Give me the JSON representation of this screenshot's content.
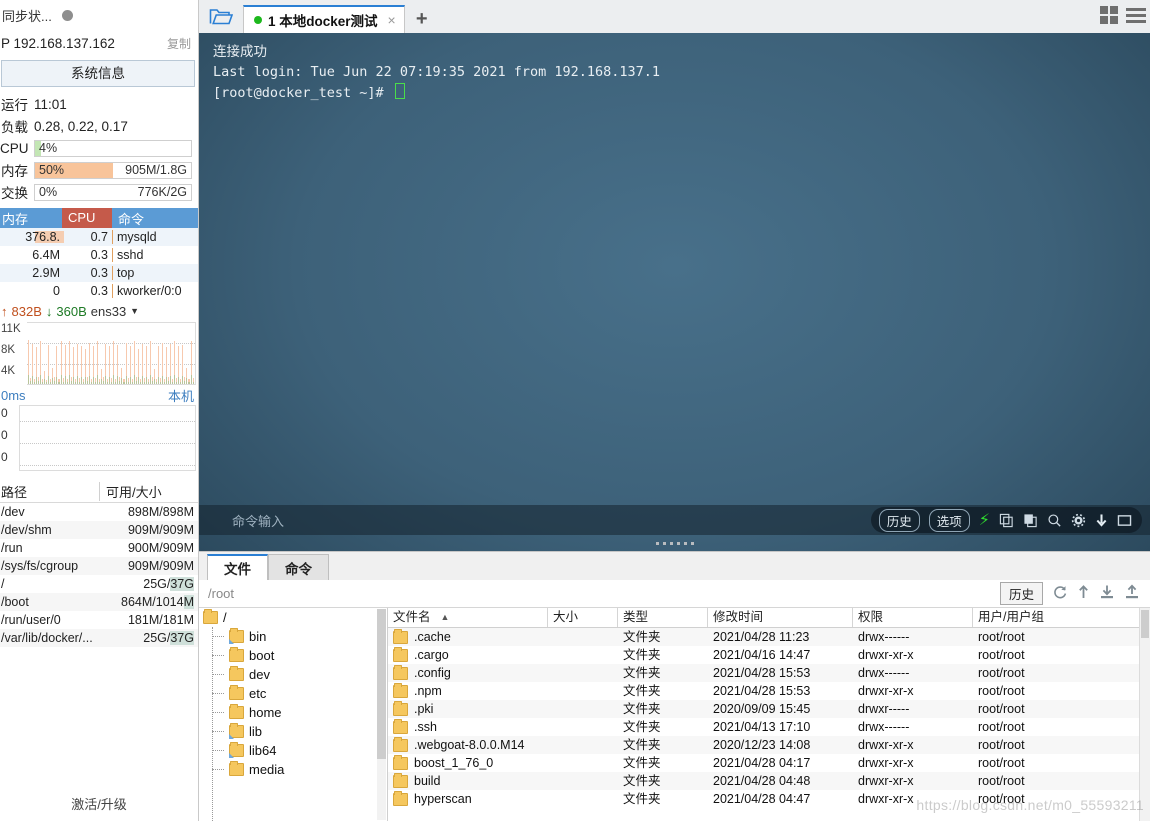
{
  "monitor": {
    "sync_label": "同步状...",
    "ip_label": "P 192.168.137.162",
    "copy_label": "复制",
    "sysinfo_button": "系统信息",
    "uptime_key": "运行",
    "uptime_value": "11:01",
    "load_key": "负载",
    "load_value": "0.28, 0.22, 0.17",
    "meters": [
      {
        "key": "CPU",
        "percent": "4%",
        "detail": "",
        "fill_pct": 4,
        "color": "#c3e6b4"
      },
      {
        "key": "内存",
        "percent": "50%",
        "detail": "905M/1.8G",
        "fill_pct": 50,
        "color": "#f8c49a"
      },
      {
        "key": "交换",
        "percent": "0%",
        "detail": "776K/2G",
        "fill_pct": 0,
        "color": "#f8c49a"
      }
    ],
    "process_table": {
      "headers": [
        "内存",
        "CPU",
        "命令"
      ],
      "rows": [
        {
          "mem": "376.8.",
          "cpu": "0.7",
          "cmd": "mysqld",
          "membar": 46
        },
        {
          "mem": "6.4M",
          "cpu": "0.3",
          "cmd": "sshd",
          "membar": 0
        },
        {
          "mem": "2.9M",
          "cpu": "0.3",
          "cmd": "top",
          "membar": 0
        },
        {
          "mem": "0",
          "cpu": "0.3",
          "cmd": "kworker/0:0",
          "membar": 0
        }
      ]
    },
    "network": {
      "upload": "832B",
      "download": "360B",
      "interface": "ens33",
      "y_labels": [
        "11K",
        "8K",
        "4K"
      ],
      "bars": [
        72,
        10,
        66,
        8,
        60,
        12,
        70,
        9,
        22,
        7,
        64,
        9,
        26,
        11,
        62,
        8,
        70,
        10,
        64,
        9,
        70,
        12,
        60,
        8,
        66,
        10,
        62,
        9,
        58,
        11,
        68,
        8,
        62,
        10,
        70,
        9,
        24,
        12,
        66,
        8,
        62,
        10,
        70,
        9,
        64,
        11,
        26,
        8,
        68,
        10,
        62,
        9,
        70,
        12,
        58,
        8,
        66,
        10,
        62,
        9,
        70,
        11,
        24,
        8,
        62,
        10,
        68,
        9,
        60,
        12,
        66,
        8,
        70,
        10,
        62,
        9,
        64,
        11,
        26,
        8,
        70,
        10
      ],
      "bars_base": [
        14,
        5,
        13,
        4,
        12,
        5,
        14,
        4,
        9,
        4,
        13,
        4,
        10,
        5,
        12,
        4,
        14,
        4,
        13,
        4,
        14,
        5,
        12,
        4,
        13,
        4,
        12,
        4,
        11,
        5,
        13,
        4,
        12,
        4,
        14,
        4,
        9,
        5,
        13,
        4,
        12,
        4,
        14,
        4,
        13,
        5,
        10,
        4,
        13,
        4,
        12,
        4,
        14,
        5,
        11,
        4,
        13,
        4,
        12,
        4,
        14,
        5,
        9,
        4,
        12,
        4,
        13,
        4,
        12,
        5,
        13,
        4,
        14,
        4,
        12,
        4,
        13,
        5,
        10,
        4,
        14,
        4
      ]
    },
    "ping": {
      "left_label": "0ms",
      "right_label": "本机",
      "y_labels": [
        "0",
        "0",
        "0"
      ]
    },
    "disk_table": {
      "headers": [
        "路径",
        "可用/大小"
      ],
      "rows": [
        {
          "path": "/dev",
          "value": "898M/898M",
          "hl": ""
        },
        {
          "path": "/dev/shm",
          "value": "909M/909M",
          "hl": ""
        },
        {
          "path": "/run",
          "value": "900M/909M",
          "hl": ""
        },
        {
          "path": "/sys/fs/cgroup",
          "value": "909M/909M",
          "hl": ""
        },
        {
          "path": "/",
          "value": "25G/37G",
          "hl": "37G"
        },
        {
          "path": "/boot",
          "value": "864M/1014M",
          "hl": "M"
        },
        {
          "path": "/run/user/0",
          "value": "181M/181M",
          "hl": ""
        },
        {
          "path": "/var/lib/docker/...",
          "value": "25G/37G",
          "hl": "37G"
        }
      ]
    },
    "activate_label": "激活/升级"
  },
  "tabbar": {
    "open_icon": "open-folder-icon",
    "tab_title": "1 本地docker测试",
    "tab_close": "×",
    "new_tab": "+",
    "grid_icon": "grid-view-icon",
    "list_icon": "list-view-icon"
  },
  "terminal": {
    "line1": "连接成功",
    "line2": "Last login: Tue Jun 22 07:19:35 2021 from 192.168.137.1",
    "line3": "[root@docker_test ~]# ",
    "command_placeholder": "命令输入",
    "history_button": "历史",
    "options_button": "选项",
    "icons": [
      "bolt-icon",
      "copy-icon",
      "paste-icon",
      "search-icon",
      "gear-icon",
      "download-icon",
      "window-icon"
    ]
  },
  "filemanager": {
    "tabs": [
      {
        "label": "文件",
        "active": true
      },
      {
        "label": "命令",
        "active": false
      }
    ],
    "path": "/root",
    "history_button": "历史",
    "tool_icons": [
      "refresh-icon",
      "upload-arrow-icon",
      "download-icon",
      "upload-icon"
    ],
    "tree": [
      {
        "label": "/",
        "root": true,
        "link": false
      },
      {
        "label": "bin",
        "root": false,
        "link": true
      },
      {
        "label": "boot",
        "root": false,
        "link": false
      },
      {
        "label": "dev",
        "root": false,
        "link": false
      },
      {
        "label": "etc",
        "root": false,
        "link": false
      },
      {
        "label": "home",
        "root": false,
        "link": false
      },
      {
        "label": "lib",
        "root": false,
        "link": true
      },
      {
        "label": "lib64",
        "root": false,
        "link": true
      },
      {
        "label": "media",
        "root": false,
        "link": false
      }
    ],
    "columns": [
      "文件名",
      "大小",
      "类型",
      "修改时间",
      "权限",
      "用户/用户组"
    ],
    "sort_indicator": "▲",
    "rows": [
      {
        "name": ".cache",
        "size": "",
        "type": "文件夹",
        "time": "2021/04/28 11:23",
        "perm": "drwx------",
        "owner": "root/root"
      },
      {
        "name": ".cargo",
        "size": "",
        "type": "文件夹",
        "time": "2021/04/16 14:47",
        "perm": "drwxr-xr-x",
        "owner": "root/root"
      },
      {
        "name": ".config",
        "size": "",
        "type": "文件夹",
        "time": "2021/04/28 15:53",
        "perm": "drwx------",
        "owner": "root/root"
      },
      {
        "name": ".npm",
        "size": "",
        "type": "文件夹",
        "time": "2021/04/28 15:53",
        "perm": "drwxr-xr-x",
        "owner": "root/root"
      },
      {
        "name": ".pki",
        "size": "",
        "type": "文件夹",
        "time": "2020/09/09 15:45",
        "perm": "drwxr-----",
        "owner": "root/root"
      },
      {
        "name": ".ssh",
        "size": "",
        "type": "文件夹",
        "time": "2021/04/13 17:10",
        "perm": "drwx------",
        "owner": "root/root"
      },
      {
        "name": ".webgoat-8.0.0.M14",
        "size": "",
        "type": "文件夹",
        "time": "2020/12/23 14:08",
        "perm": "drwxr-xr-x",
        "owner": "root/root"
      },
      {
        "name": "boost_1_76_0",
        "size": "",
        "type": "文件夹",
        "time": "2021/04/28 04:17",
        "perm": "drwxr-xr-x",
        "owner": "root/root"
      },
      {
        "name": "build",
        "size": "",
        "type": "文件夹",
        "time": "2021/04/28 04:48",
        "perm": "drwxr-xr-x",
        "owner": "root/root"
      },
      {
        "name": "hyperscan",
        "size": "",
        "type": "文件夹",
        "time": "2021/04/28 04:47",
        "perm": "drwxr-xr-x",
        "owner": "root/root"
      }
    ]
  },
  "watermark": "https://blog.csdn.net/m0_55593211"
}
